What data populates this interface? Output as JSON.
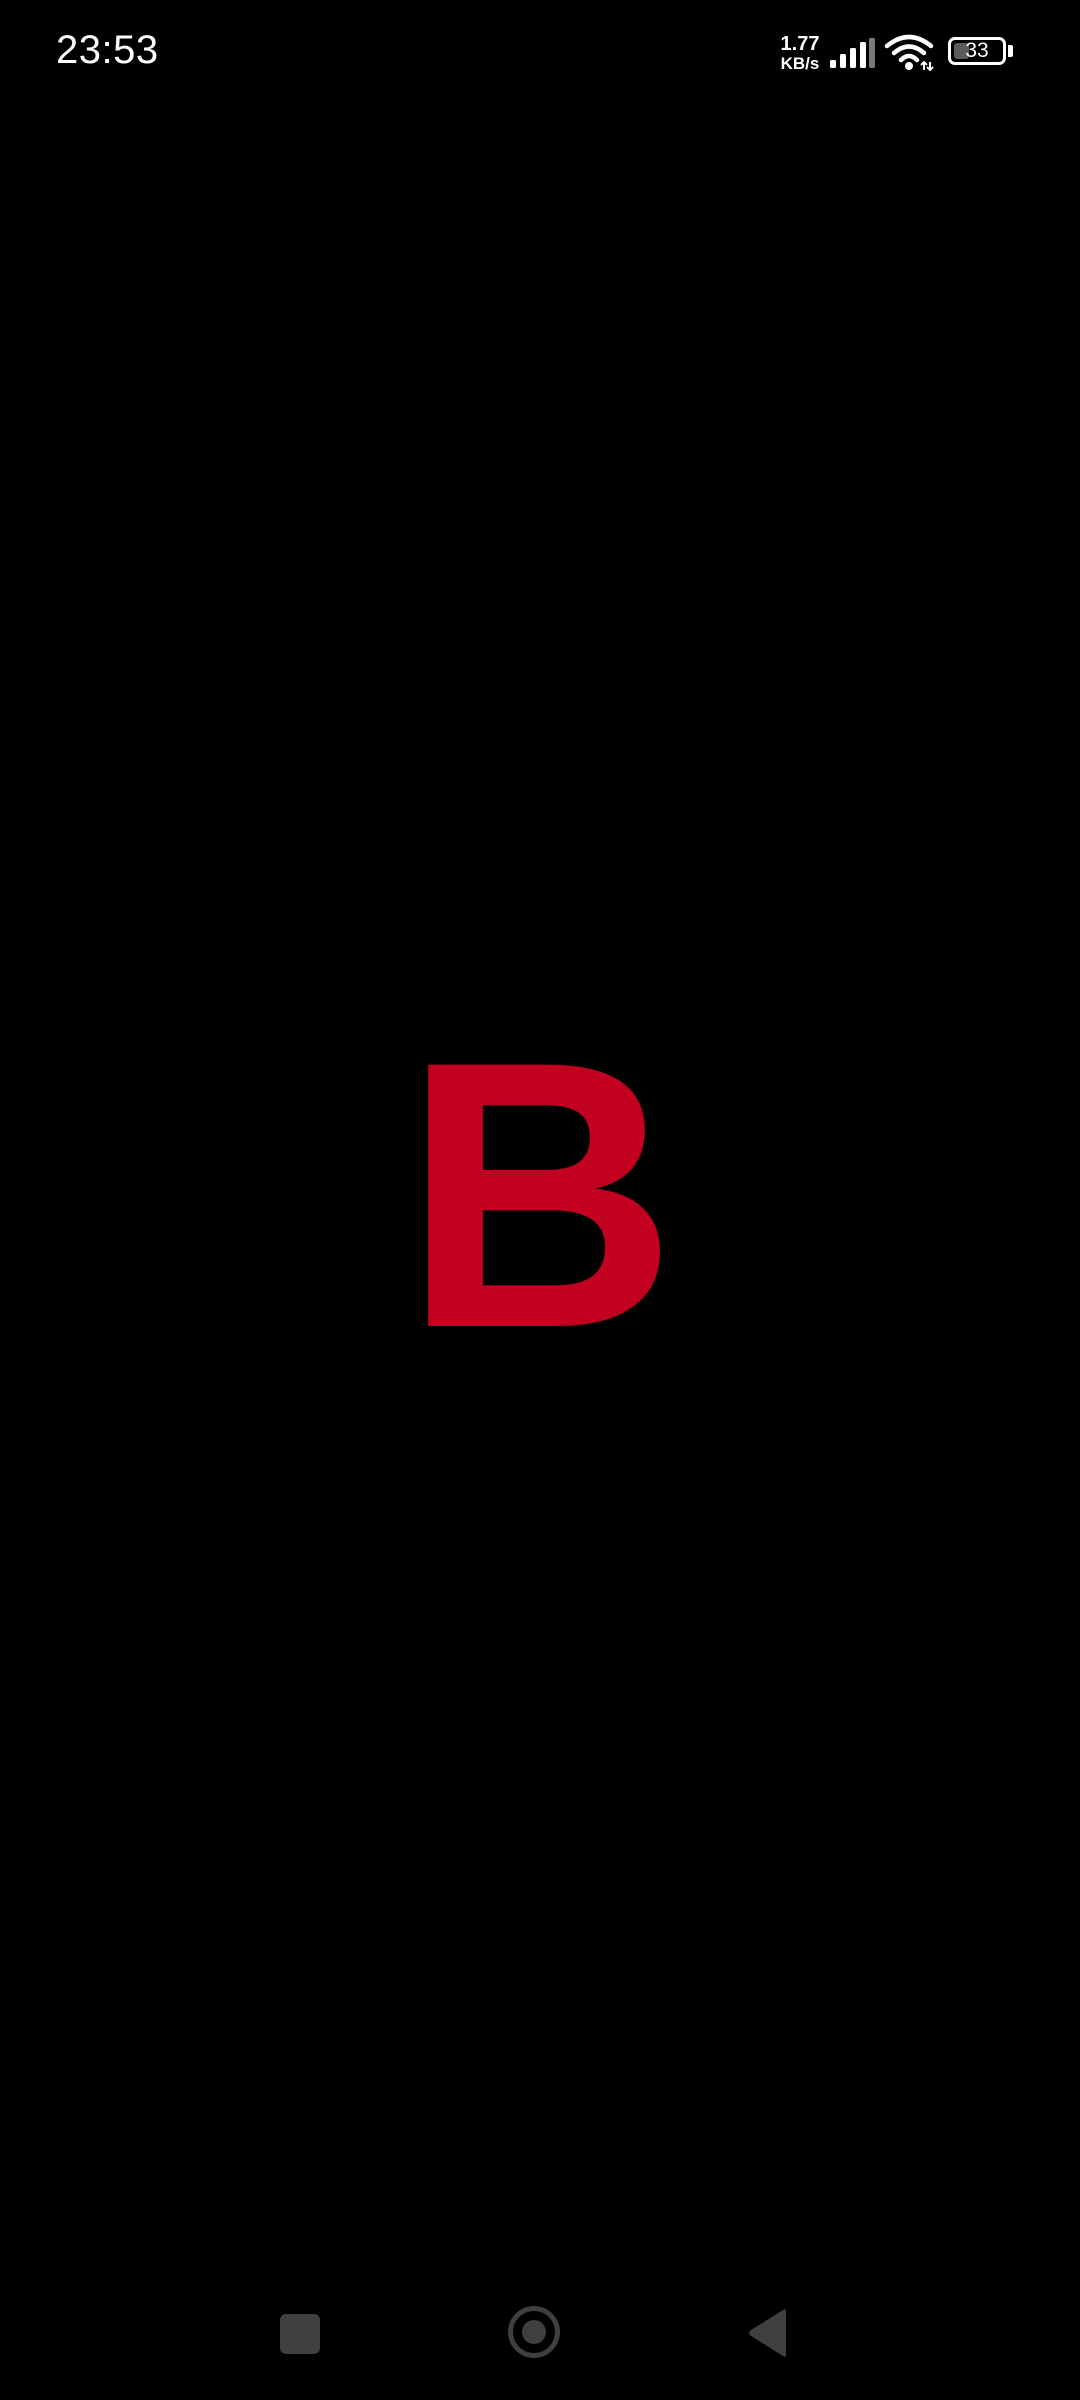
{
  "status_bar": {
    "time": "23:53",
    "net_speed_value": "1.77",
    "net_speed_unit": "KB/s",
    "battery_level": "33",
    "battery_fraction": 0.33,
    "icons": [
      "signal-icon",
      "wifi-icon",
      "battery-icon"
    ]
  },
  "splash": {
    "logo_letter": "B",
    "logo_color": "#c2001f"
  },
  "nav_bar": {
    "icons": [
      "recents-icon",
      "home-icon",
      "back-icon"
    ]
  }
}
